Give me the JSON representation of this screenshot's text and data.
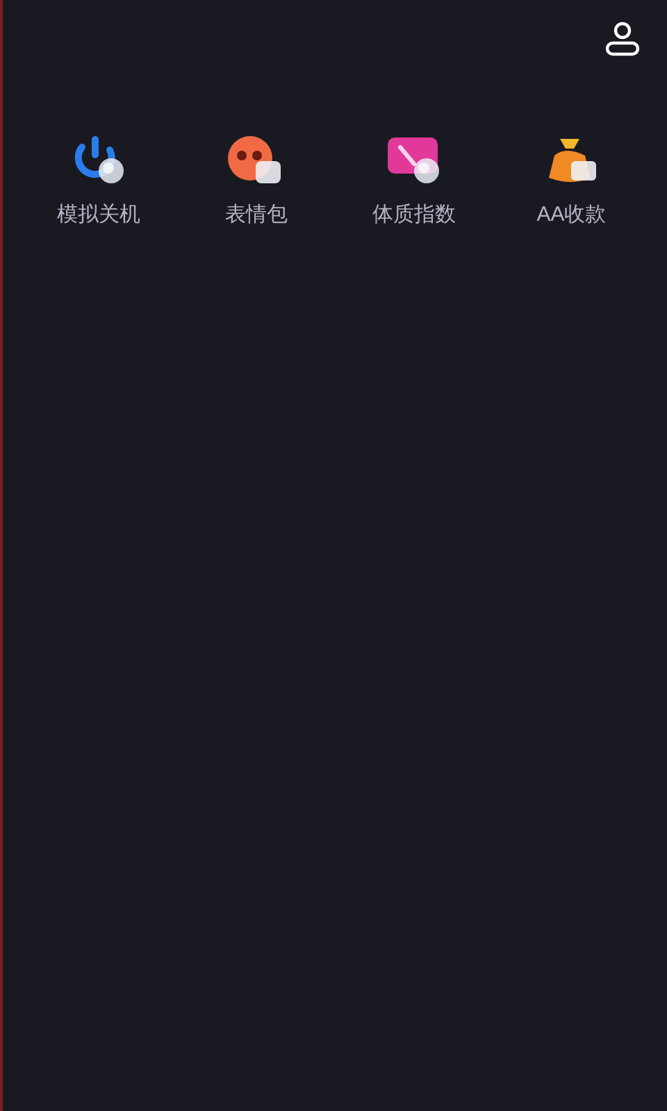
{
  "tools": [
    {
      "kind": "power",
      "label": "模拟关机"
    },
    {
      "kind": "face",
      "label": "表情包"
    },
    {
      "kind": "gauge",
      "label": "体质指数"
    },
    {
      "kind": "moneybag",
      "label": "AA收款"
    }
  ]
}
